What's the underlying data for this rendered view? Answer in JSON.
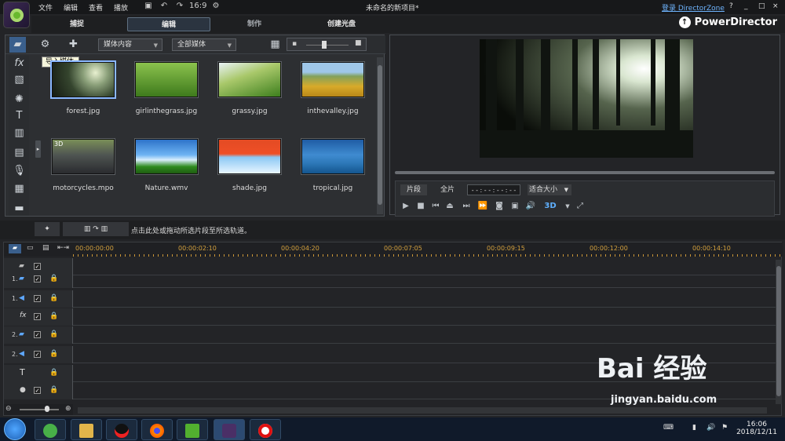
{
  "menu": {
    "file": "文件",
    "edit": "编辑",
    "view": "查看",
    "play": "播放"
  },
  "window": {
    "title": "未命名的新项目*",
    "login": "登录 DirectorZone",
    "help": "?"
  },
  "modes": {
    "capture": "捕捉",
    "edit": "编辑",
    "produce": "制作",
    "disc": "创建光盘"
  },
  "brand": {
    "name": "PowerDirector"
  },
  "library": {
    "content_dropdown": "媒体内容",
    "filter_dropdown": "全部媒体",
    "tooltip": "导入媒体",
    "items": [
      {
        "name": "forest.jpg"
      },
      {
        "name": "girlinthegrass.jpg"
      },
      {
        "name": "grassy.jpg"
      },
      {
        "name": "inthevalley.jpg"
      },
      {
        "name": "motorcycles.mpo",
        "badge": "3D"
      },
      {
        "name": "Nature.wmv"
      },
      {
        "name": "shade.jpg"
      },
      {
        "name": "tropical.jpg"
      }
    ]
  },
  "preview": {
    "clip_tab": "片段",
    "movie_tab": "全片",
    "timecode": "- - : - - : - - : - -",
    "fit": "适合大小",
    "three_d": "3D"
  },
  "midbar": {
    "hint": "点击此处或拖动所选片段至所选轨道。"
  },
  "timeline": {
    "ticks": [
      "00:00:00:00",
      "00:00:02:10",
      "00:00:04:20",
      "00:00:07:05",
      "00:00:09:15",
      "00:00:12:00",
      "00:00:14:10"
    ],
    "tracks": [
      {
        "num": "",
        "kind": "video-icon"
      },
      {
        "num": "1.",
        "kind": "video-icon"
      },
      {
        "num": "1.",
        "kind": "audio-icon"
      },
      {
        "num": "",
        "kind": "fx-icon",
        "text": "fx"
      },
      {
        "num": "2.",
        "kind": "video-icon"
      },
      {
        "num": "2.",
        "kind": "audio-icon"
      },
      {
        "num": "",
        "kind": "title-icon",
        "text": "T"
      },
      {
        "num": "",
        "kind": "mic-icon"
      },
      {
        "num": "",
        "kind": "music-icon"
      }
    ]
  },
  "taskbar": {
    "time": "16:06",
    "date": "2018/12/11"
  },
  "watermark": {
    "text": "Bai 经验",
    "url": "jingyan.baidu.com"
  }
}
